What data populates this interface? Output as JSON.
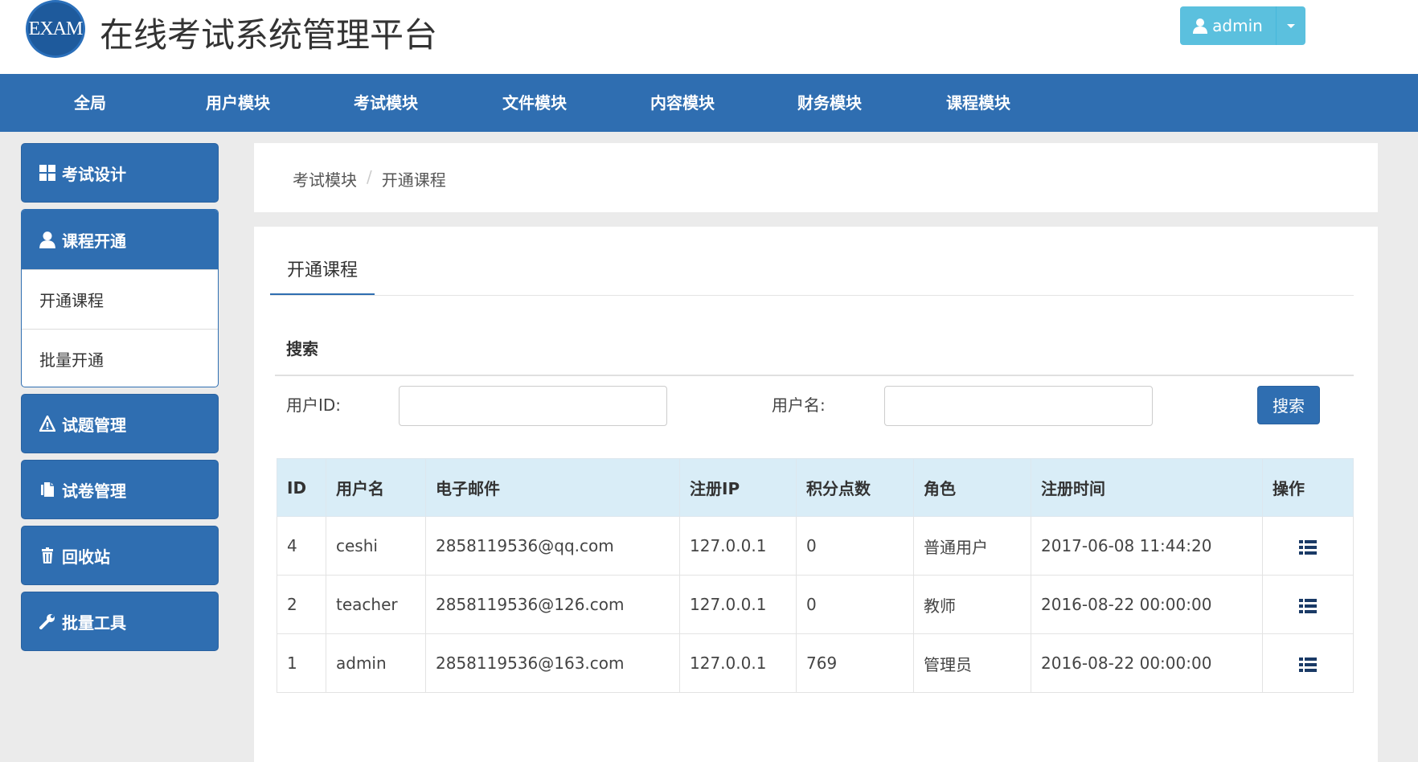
{
  "header": {
    "logo_text": "EXAM",
    "title": "在线考试系统管理平台",
    "user_label": "admin",
    "user_icon": "user-icon",
    "accent": "#5bc0de"
  },
  "topnav": {
    "color": "#2f6eb1",
    "items": [
      "全局",
      "用户模块",
      "考试模块",
      "文件模块",
      "内容模块",
      "财务模块",
      "课程模块"
    ]
  },
  "sidebar": {
    "exam_design": {
      "label": "考试设计",
      "icon": "grid-icon"
    },
    "course_open": {
      "label": "课程开通",
      "icon": "user-icon",
      "subitems": [
        "开通课程",
        "批量开通"
      ]
    },
    "question_mgmt": {
      "label": "试题管理",
      "icon": "warning-icon"
    },
    "paper_mgmt": {
      "label": "试卷管理",
      "icon": "file-icon"
    },
    "recycle": {
      "label": "回收站",
      "icon": "trash-icon"
    },
    "batch_tools": {
      "label": "批量工具",
      "icon": "wrench-icon"
    }
  },
  "breadcrumb": {
    "parent": "考试模块",
    "separator": "/",
    "current": "开通课程"
  },
  "main": {
    "tab_label": "开通课程",
    "search_title": "搜索",
    "user_id_label": "用户ID:",
    "user_id_value": "",
    "username_label": "用户名:",
    "username_value": "",
    "search_button": "搜索"
  },
  "table": {
    "headers": [
      "ID",
      "用户名",
      "电子邮件",
      "注册IP",
      "积分点数",
      "角色",
      "注册时间",
      "操作"
    ],
    "rows": [
      {
        "id": "4",
        "username": "ceshi",
        "email": "2858119536@qq.com",
        "ip": "127.0.0.1",
        "points": "0",
        "role": "普通用户",
        "reg_time": "2017-06-08 11:44:20",
        "op_icon": "list-icon"
      },
      {
        "id": "2",
        "username": "teacher",
        "email": "2858119536@126.com",
        "ip": "127.0.0.1",
        "points": "0",
        "role": "教师",
        "reg_time": "2016-08-22 00:00:00",
        "op_icon": "list-icon"
      },
      {
        "id": "1",
        "username": "admin",
        "email": "2858119536@163.com",
        "ip": "127.0.0.1",
        "points": "769",
        "role": "管理员",
        "reg_time": "2016-08-22 00:00:00",
        "op_icon": "list-icon"
      }
    ]
  }
}
